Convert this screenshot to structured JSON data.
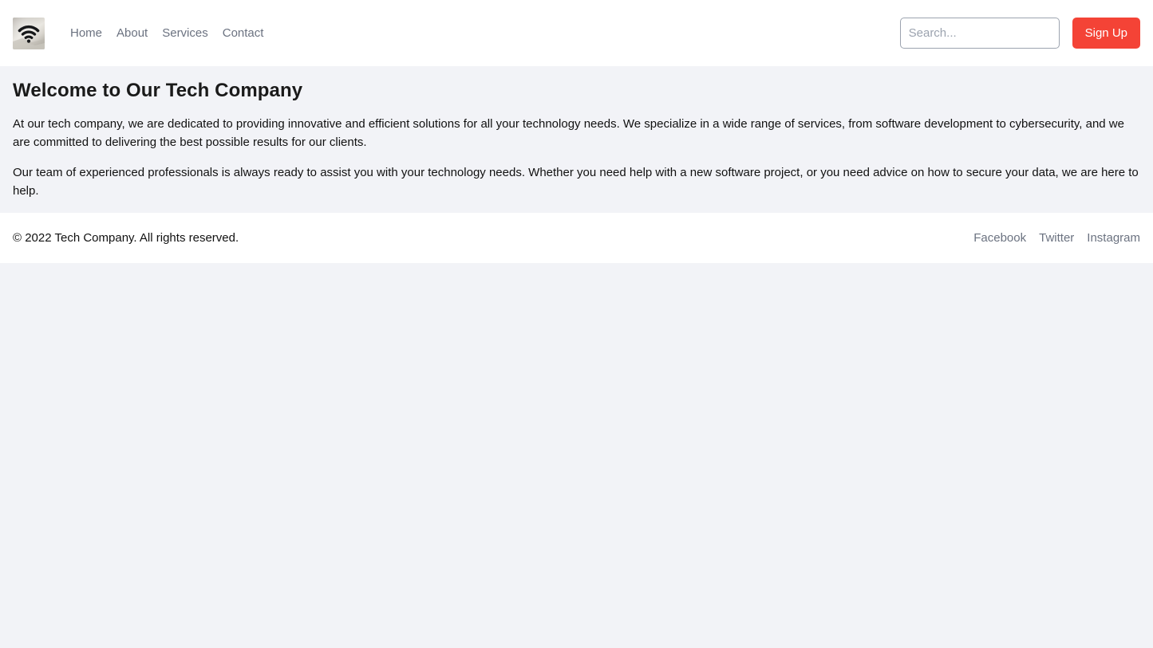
{
  "theme": {
    "page_background": "#f2f3f7",
    "surface": "#ffffff",
    "accent": "#f44336",
    "muted_text": "#6b7280",
    "body_text": "#111111"
  },
  "header": {
    "logo": {
      "icon": "wifi-logo-image",
      "alt": "Tech company logo"
    },
    "nav": [
      {
        "label": "Home"
      },
      {
        "label": "About"
      },
      {
        "label": "Services"
      },
      {
        "label": "Contact"
      }
    ],
    "search": {
      "placeholder": "Search...",
      "value": ""
    },
    "signup_label": "Sign Up"
  },
  "main": {
    "title": "Welcome to Our Tech Company",
    "paragraphs": [
      "At our tech company, we are dedicated to providing innovative and efficient solutions for all your technology needs. We specialize in a wide range of services, from software development to cybersecurity, and we are committed to delivering the best possible results for our clients.",
      "Our team of experienced professionals is always ready to assist you with your technology needs. Whether you need help with a new software project, or you need advice on how to secure your data, we are here to help."
    ]
  },
  "footer": {
    "copyright": "© 2022 Tech Company. All rights reserved.",
    "social": [
      {
        "label": "Facebook"
      },
      {
        "label": "Twitter"
      },
      {
        "label": "Instagram"
      }
    ]
  }
}
